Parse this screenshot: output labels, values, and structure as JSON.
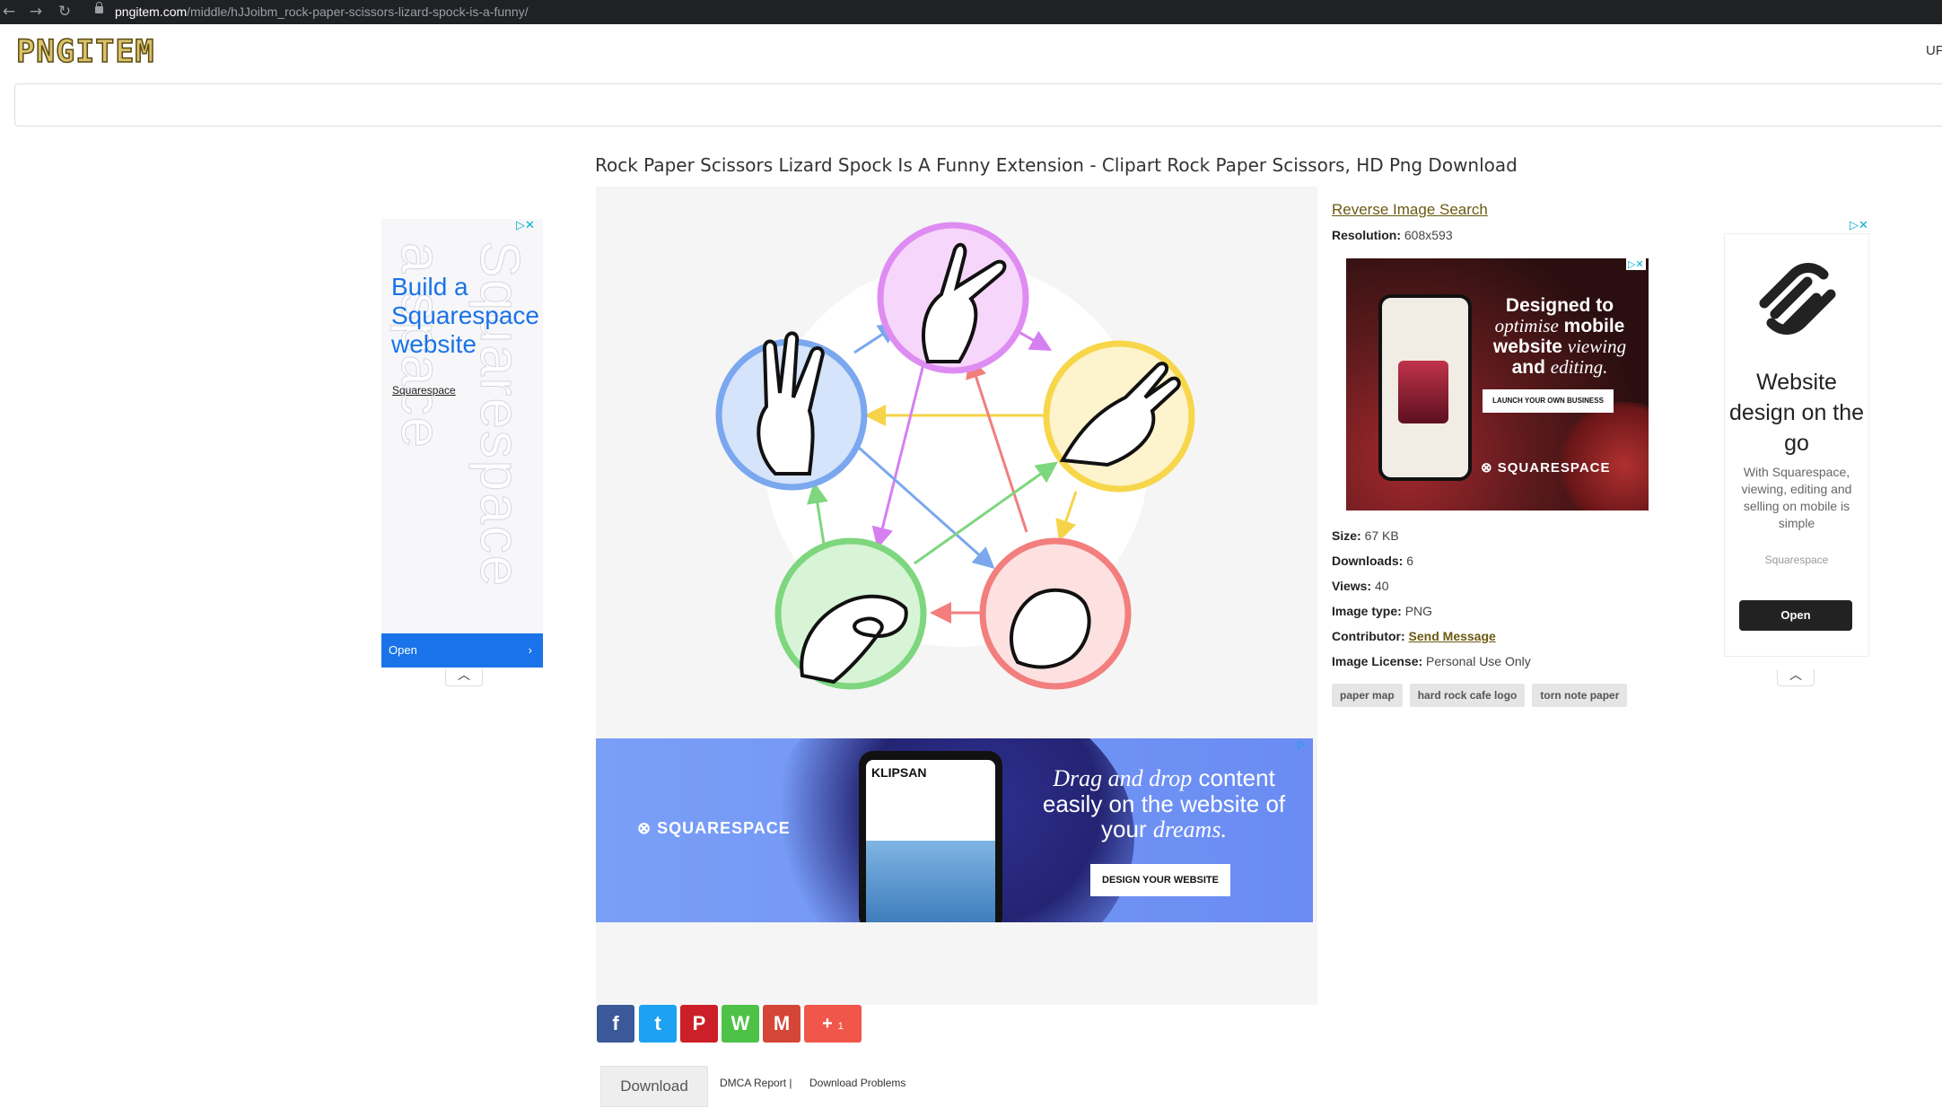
{
  "browser": {
    "url_domain": "pngitem.com",
    "url_path": "/middle/hJJoibm_rock-paper-scissors-lizard-spock-is-a-funny/"
  },
  "header": {
    "logo": "PNGITEM",
    "right_text": "UF"
  },
  "page": {
    "title": "Rock Paper Scissors Lizard Spock Is A Funny Extension - Clipart Rock Paper Scissors, HD Png Download"
  },
  "details": {
    "reverse_search": "Reverse Image Search",
    "resolution_label": "Resolution:",
    "resolution_value": "608x593",
    "size_label": "Size:",
    "size_value": "67 KB",
    "downloads_label": "Downloads:",
    "downloads_value": "6",
    "views_label": "Views:",
    "views_value": "40",
    "type_label": "Image type:",
    "type_value": "PNG",
    "contributor_label": "Contributor:",
    "contributor_link": "Send Message",
    "license_label": "Image License:",
    "license_value": "Personal Use Only",
    "tags": [
      "paper map",
      "hard rock cafe logo",
      "torn note paper"
    ]
  },
  "ad_left": {
    "headline": "Build a Squarespace website",
    "brand": "Squarespace",
    "watermark": "Squarespace",
    "open_label": "Open"
  },
  "ad_middle": {
    "headline_part1": "Designed to",
    "headline_italic1": "optimise",
    "headline_part2": "mobile website",
    "headline_italic2": "viewing",
    "headline_part3": "and",
    "headline_italic3": "editing.",
    "button": "LAUNCH YOUR OWN BUSINESS",
    "brand": "SQUARESPACE"
  },
  "ad_right": {
    "headline": "Website design on the go",
    "body": "With Squarespace, viewing, editing and selling on mobile is simple",
    "brand": "Squarespace",
    "open_label": "Open"
  },
  "ad_banner": {
    "brand": "SQUARESPACE",
    "phone_brand": "KLIPSAN",
    "headline_italic": "Drag and drop",
    "headline_rest": "content easily on the website of your",
    "headline_italic2": "dreams.",
    "button": "DESIGN YOUR WEBSITE"
  },
  "share": {
    "facebook": "f",
    "twitter": "t",
    "pinterest": "P",
    "whatsapp": "W",
    "gmail": "M",
    "more_count": "1"
  },
  "actions": {
    "download": "Download",
    "dmca": "DMCA Report |",
    "problems": "Download Problems"
  },
  "colors": {
    "logo_gold": "#d9c26a",
    "link_brown": "#6b5a11",
    "ad_blue": "#1a73e8",
    "facebook": "#3b5998",
    "twitter": "#1da1f2",
    "pinterest": "#cb2027",
    "whatsapp": "#4dc247",
    "gmail": "#d44638",
    "more": "#f0574a"
  }
}
